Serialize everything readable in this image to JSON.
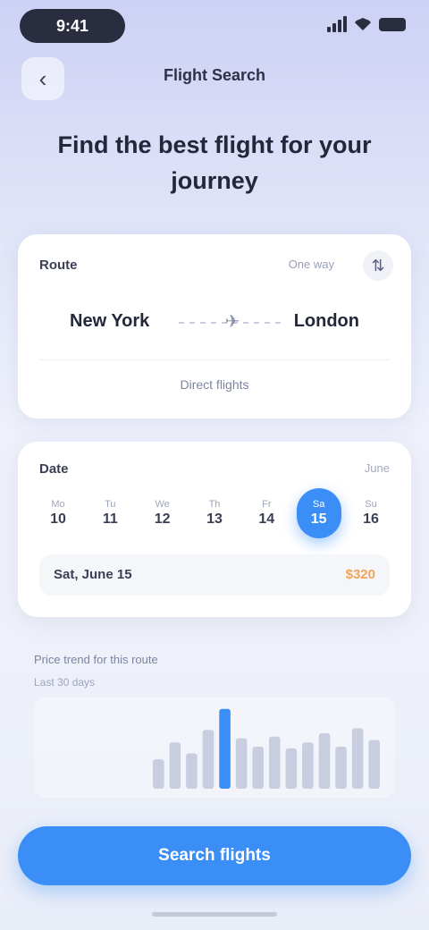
{
  "status": {
    "time": "9:41"
  },
  "nav": {
    "back_icon": "chevron-left-icon",
    "title": "Flight Search"
  },
  "headline": "Find the best flight for your journey",
  "route": {
    "label": "Route",
    "meta": "One way",
    "swap_icon": "swap-icon",
    "from": "New York",
    "to": "London",
    "note": "Direct flights"
  },
  "date": {
    "label": "Date",
    "month": "June",
    "days": [
      {
        "w": "Mo",
        "n": "10"
      },
      {
        "w": "Tu",
        "n": "11"
      },
      {
        "w": "We",
        "n": "12"
      },
      {
        "w": "Th",
        "n": "13"
      },
      {
        "w": "Fr",
        "n": "14"
      },
      {
        "w": "Sa",
        "n": "15"
      },
      {
        "w": "Su",
        "n": "16"
      }
    ],
    "active_index": 5,
    "selected_label": "Sat, June 15",
    "price": "$320"
  },
  "trend": {
    "title": "Price trend for this route",
    "subtitle": "Last 30 days",
    "values": [
      0.35,
      0.55,
      0.42,
      0.7,
      0.95,
      0.6,
      0.5,
      0.62,
      0.48,
      0.55,
      0.66,
      0.5,
      0.72,
      0.58
    ],
    "highlight_index": 4
  },
  "cta": "Search flights",
  "colors": {
    "accent": "#3a8ef6",
    "price": "#f3a35a"
  }
}
